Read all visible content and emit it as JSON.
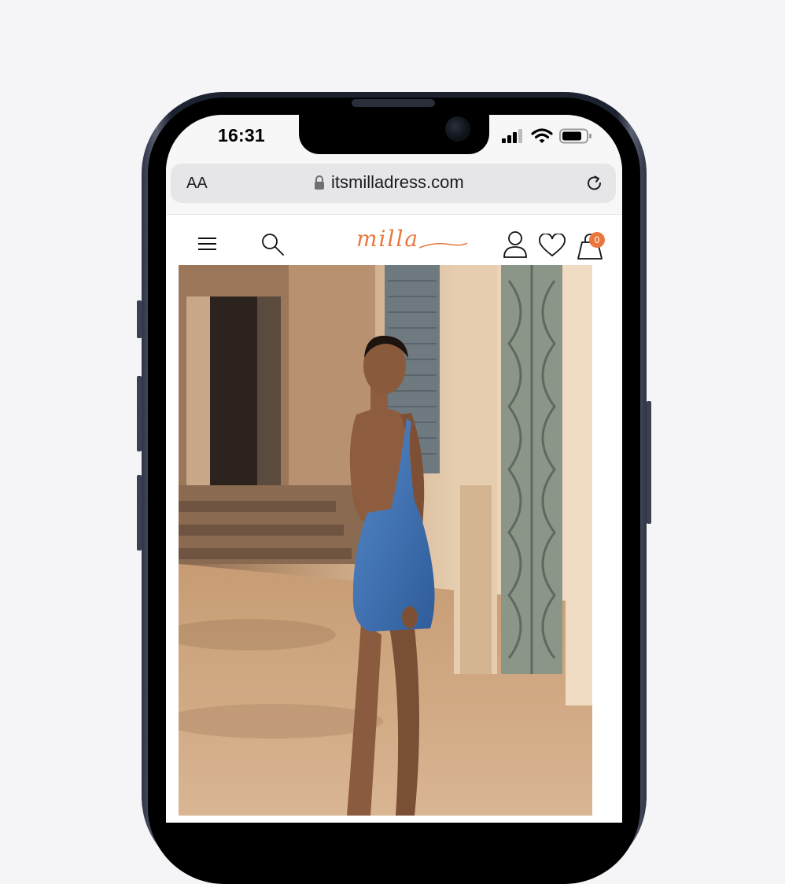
{
  "status_bar": {
    "time": "16:31"
  },
  "browser": {
    "text_size_button": "AA",
    "url": "itsmilladress.com"
  },
  "site": {
    "logo_text": "milla",
    "cart_count": "0"
  },
  "colors": {
    "brand_orange": "#e9773d",
    "dress_blue": "#3f6fb2"
  },
  "icons": [
    "signal-icon",
    "wifi-icon",
    "battery-icon",
    "lock-icon",
    "reload-icon",
    "menu-icon",
    "search-icon",
    "account-icon",
    "wishlist-icon",
    "cart-icon"
  ]
}
